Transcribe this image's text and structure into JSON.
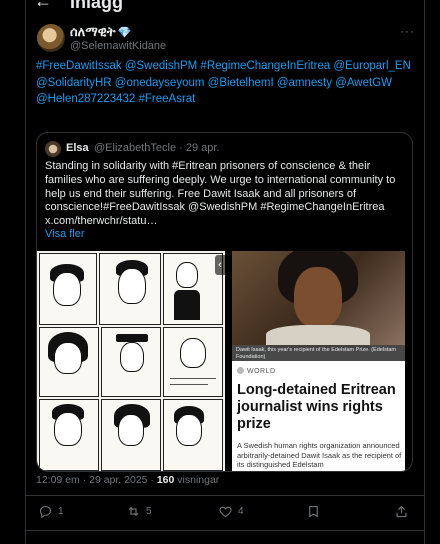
{
  "header": {
    "title": "Inlägg"
  },
  "tweet": {
    "author_name": "ሰለማዊት",
    "author_badge": "💎",
    "handle": "@SelemawitKidane",
    "body": "#FreeDawitIssak @SwedishPM #RegimeChangeInEritrea @Europarl_EN @SolidarityHR @onedayseyoum @BietelhemI @amnesty @AwetGW @Helen287223432 #FreeAsrat",
    "time": "12:09 em · 29 apr. 2025 · ",
    "views_count": "160",
    "views_label": " visningar",
    "replies": "1",
    "reposts": "5",
    "likes": "4"
  },
  "quote": {
    "name": "Elsa",
    "handle": "@ElizabethTecle · 29 apr.",
    "text": "Standing in solidarity with #Eritrean prisoners of conscience & their families who are suffering deeply. We urge to international community to help us end their suffering. Free Dawit Isaak and all prisoners of conscience!#FreeDawitIssak @SwedishPM #RegimeChangeInEritrea  x.com/therwchr/statu…",
    "show_more": "Visa fler",
    "article": {
      "caption": "Dawit Isaak, this year's recipient of the Edelstam Prize. (Edelstam Foundation)",
      "section": "WORLD",
      "headline": "Long-detained Eritrean journalist wins rights prize",
      "lede": "A Swedish human rights organization announced arbitrarily-detained Dawit Isaak as the recipient of its distinguished Edelstam"
    }
  },
  "icons": {
    "reply": "reply-icon",
    "repost": "repost-icon",
    "like": "heart-icon",
    "bookmark": "bookmark-icon",
    "share": "share-icon",
    "more": "more-icon"
  },
  "colors": {
    "link": "#1d9bf0",
    "muted": "#71767b",
    "text": "#e7e9ea",
    "border": "#2f3336"
  }
}
